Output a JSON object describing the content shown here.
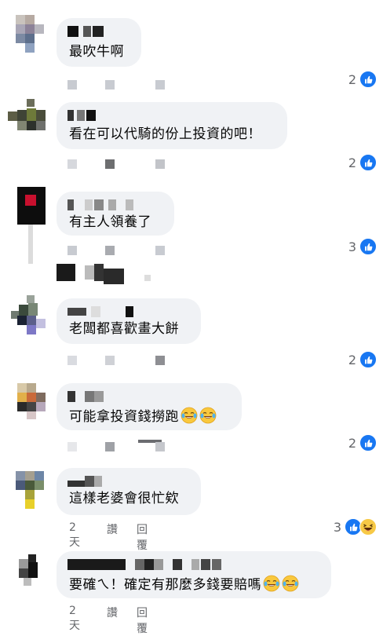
{
  "comments": [
    {
      "text": "最吹牛啊",
      "reaction_count": "2",
      "reactions": [
        "like-icon"
      ]
    },
    {
      "text": "看在可以代騎的份上投資的吧！",
      "reaction_count": "2",
      "reactions": [
        "like-icon"
      ]
    },
    {
      "text": "有主人領養了",
      "reaction_count": "3",
      "reactions": [
        "like-icon"
      ]
    },
    {
      "text": "老闆都喜歡畫大餅",
      "reaction_count": "2",
      "reactions": [
        "like-icon"
      ]
    },
    {
      "text": "可能拿投資錢撈跑",
      "emoji": [
        "tears-of-joy-emoji",
        "tears-of-joy-emoji"
      ],
      "reaction_count": "2",
      "reactions": [
        "like-icon"
      ]
    },
    {
      "text": "這樣老婆會很忙欸",
      "time": "2天",
      "like_label": "讚",
      "reply_label": "回覆",
      "reaction_count": "3",
      "reactions": [
        "like-icon",
        "haha-icon"
      ]
    },
    {
      "text": "要確ㄟ！確定有那麼多錢要賠嗎",
      "emoji": [
        "tears-of-joy-emoji",
        "tears-of-joy-emoji"
      ],
      "time": "2天",
      "like_label": "讚",
      "reply_label": "回覆"
    }
  ],
  "colors": {
    "bubble": "#f0f2f5",
    "like_blue": "#1877f2",
    "meta_gray": "#65676b"
  }
}
